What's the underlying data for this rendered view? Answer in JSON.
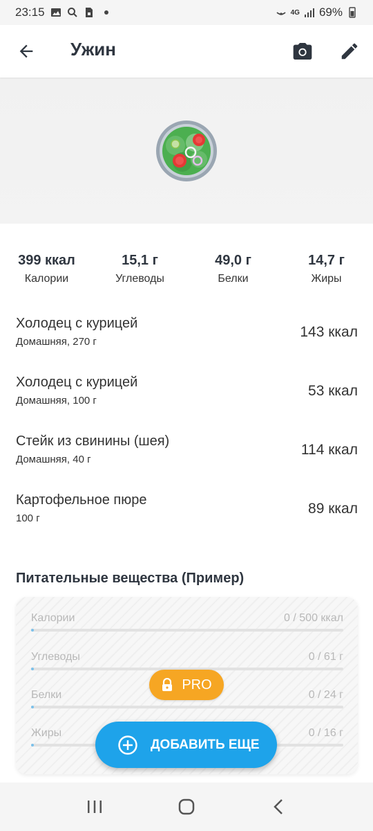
{
  "status_bar": {
    "time": "23:15",
    "battery": "69%",
    "network": "4G"
  },
  "header": {
    "title": "Ужин"
  },
  "macros": [
    {
      "value": "399 ккал",
      "label": "Калории"
    },
    {
      "value": "15,1 г",
      "label": "Углеводы"
    },
    {
      "value": "49,0 г",
      "label": "Белки"
    },
    {
      "value": "14,7 г",
      "label": "Жиры"
    }
  ],
  "foods": [
    {
      "name": "Холодец с курицей",
      "sub": "Домашняя, 270 г",
      "kcal": "143 ккал"
    },
    {
      "name": "Холодец с курицей",
      "sub": "Домашняя, 100 г",
      "kcal": "53 ккал"
    },
    {
      "name": "Стейк из свинины (шея)",
      "sub": "Домашняя, 40 г",
      "kcal": "114 ккал"
    },
    {
      "name": "Картофельное пюре",
      "sub": "100 г",
      "kcal": "89 ккал"
    }
  ],
  "nutrients": {
    "title": "Питательные вещества (Пример)",
    "rows": [
      {
        "name": "Калории",
        "value": "0 / 500 ккал",
        "progress": 0
      },
      {
        "name": "Углеводы",
        "value": "0 / 61 г",
        "progress": 0
      },
      {
        "name": "Белки",
        "value": "0 / 24 г",
        "progress": 0
      },
      {
        "name": "Жиры",
        "value": "0 / 16 г",
        "progress": 0
      }
    ]
  },
  "pro_badge": {
    "label": "PRO"
  },
  "add_button": {
    "label": "ДОБАВИТЬ ЕЩЕ"
  },
  "icons": {
    "back": "arrow-left-icon",
    "camera": "camera-icon",
    "edit": "pencil-icon",
    "lock": "lock-icon",
    "add": "plus-circle-icon",
    "nav_recent": "recent-apps-icon",
    "nav_home": "home-icon",
    "nav_back": "chevron-left-icon"
  },
  "colors": {
    "accent": "#1ea3ea",
    "pro": "#f6a623",
    "title": "#2f3640"
  }
}
